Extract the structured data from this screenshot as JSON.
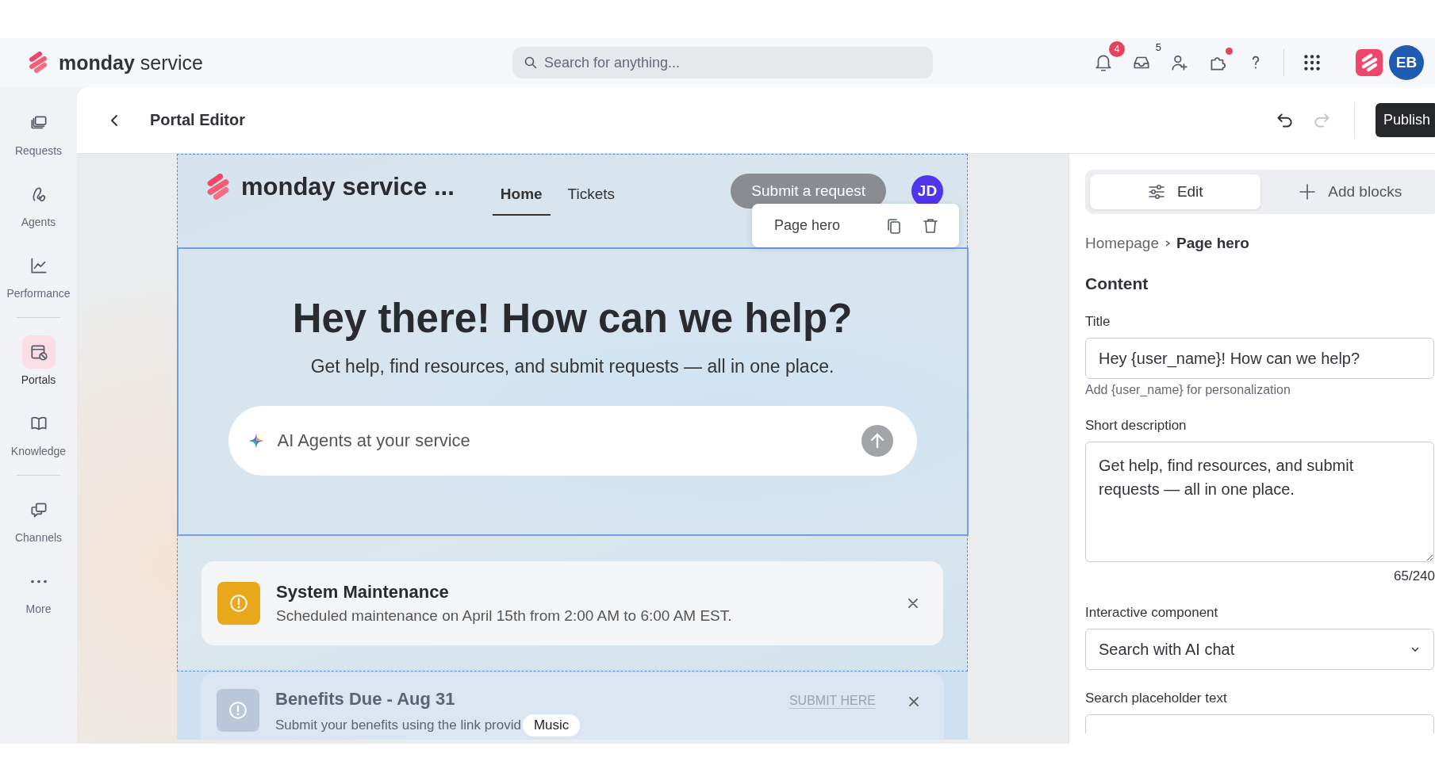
{
  "brand": {
    "name": "monday",
    "suffix": "service"
  },
  "search": {
    "placeholder": "Search for anything..."
  },
  "top_icons": [
    {
      "kind": "bell",
      "badge": "4"
    },
    {
      "kind": "inbox",
      "count": "5"
    },
    {
      "kind": "invite"
    },
    {
      "kind": "apps",
      "dot": true
    },
    {
      "kind": "help"
    },
    {
      "kind": "grid"
    }
  ],
  "user_avatar": "EB",
  "sidebar": {
    "groups": [
      [
        {
          "label": "Requests",
          "selected": false
        },
        {
          "label": "Agents",
          "selected": false
        },
        {
          "label": "Performance",
          "selected": false
        }
      ],
      [
        {
          "label": "Portals",
          "selected": true
        },
        {
          "label": "Knowledge",
          "selected": false
        }
      ],
      [
        {
          "label": "Channels",
          "selected": false
        },
        {
          "label": "More",
          "selected": false
        }
      ]
    ]
  },
  "editor": {
    "title": "Portal Editor",
    "undo": {
      "disabled": false
    },
    "redo": {
      "disabled": true
    },
    "publish": "Publish"
  },
  "preview": {
    "portal_name": "monday service ...",
    "nav": [
      {
        "label": "Home",
        "selected": true
      },
      {
        "label": "Tickets",
        "selected": false
      }
    ],
    "submit_button": "Submit a request",
    "avatar": "JD",
    "block_toolbar": {
      "label": "Page hero"
    },
    "hero": {
      "title": "Hey there! How can we help?",
      "subtitle": "Get help, find resources, and submit requests — all in one place.",
      "search_placeholder": "AI Agents at your service"
    },
    "banners": [
      {
        "kind": "warning",
        "title": "System Maintenance",
        "text": "Scheduled maintenance on April 15th from 2:00 AM to 6:00 AM EST."
      },
      {
        "kind": "info",
        "title": "Benefits Due - Aug 31",
        "text": "Submit your benefits using the link provid",
        "action": "SUBMIT HERE"
      }
    ],
    "tooltip": "Music"
  },
  "panel": {
    "tabs": [
      {
        "kind": "edit",
        "label": "Edit",
        "selected": true
      },
      {
        "kind": "add",
        "label": "Add blocks",
        "selected": false
      }
    ],
    "breadcrumb": [
      "Homepage",
      "Page hero"
    ],
    "section": "Content",
    "fields": [
      {
        "kind": "text",
        "label": "Title",
        "value": "Hey {user_name}! How can we help?",
        "hint": "Add {user_name} for personalization"
      },
      {
        "kind": "textarea",
        "label": "Short description",
        "value": "Get help, find resources, and submit requests — all in one place.",
        "counter": "65/240"
      },
      {
        "kind": "select",
        "label": "Interactive component",
        "value": "Search with AI chat"
      },
      {
        "kind": "text",
        "label": "Search placeholder text"
      }
    ]
  }
}
